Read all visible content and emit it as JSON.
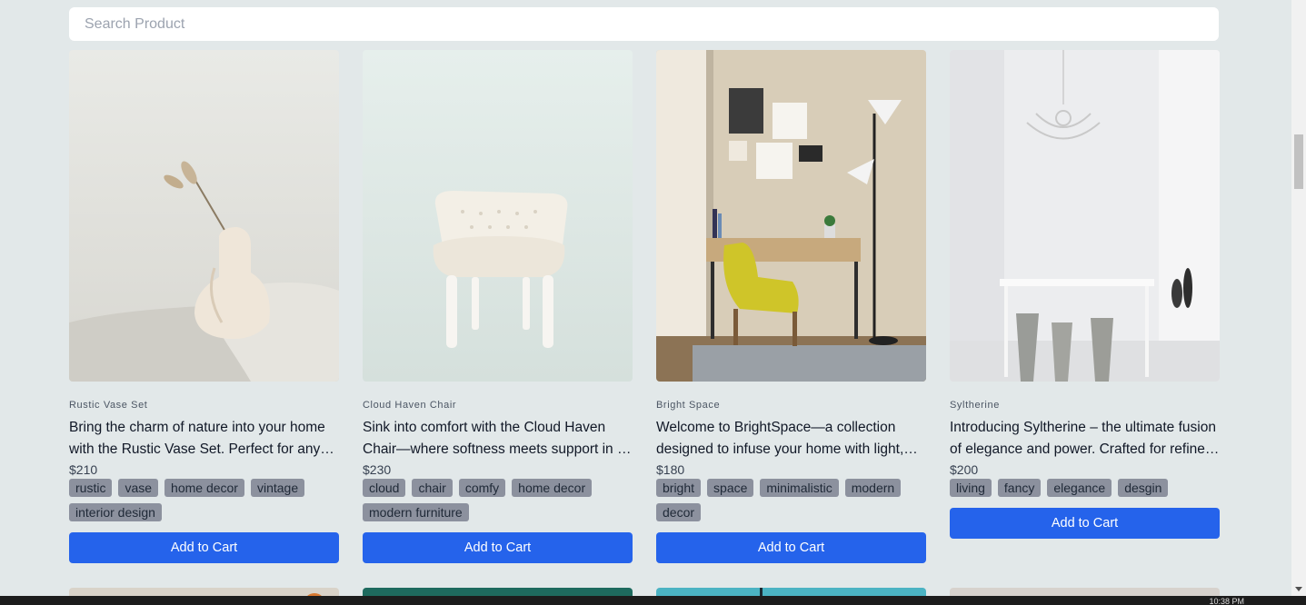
{
  "search": {
    "placeholder": "Search Product",
    "value": ""
  },
  "products": [
    {
      "name": "Rustic Vase Set",
      "description": "Bring the charm of nature into your home with the Rustic Vase Set. Perfect for any room, these vases add a touch of warmth.",
      "price": "$210",
      "tags": [
        "rustic",
        "vase",
        "home decor",
        "vintage",
        "interior design"
      ],
      "cta": "Add to Cart"
    },
    {
      "name": "Cloud Haven Chair",
      "description": "Sink into comfort with the Cloud Haven Chair—where softness meets support in a design made for relaxing.",
      "price": "$230",
      "tags": [
        "cloud",
        "chair",
        "comfy",
        "home decor",
        "modern furniture"
      ],
      "cta": "Add to Cart"
    },
    {
      "name": "Bright Space",
      "description": "Welcome to BrightSpace—a collection designed to infuse your home with light, clarity and calm.",
      "price": "$180",
      "tags": [
        "bright",
        "space",
        "minimalistic",
        "modern",
        "decor"
      ],
      "cta": "Add to Cart"
    },
    {
      "name": "Syltherine",
      "description": "Introducing Syltherine – the ultimate fusion of elegance and power. Crafted for refined living spaces.",
      "price": "$200",
      "tags": [
        "living",
        "fancy",
        "elegance",
        "desgin"
      ],
      "cta": "Add to Cart"
    }
  ],
  "taskbar": {
    "clock": "10:38 PM"
  },
  "colors": {
    "background": "#e2e8e9",
    "accent": "#2563eb",
    "tag": "#8c919e"
  }
}
